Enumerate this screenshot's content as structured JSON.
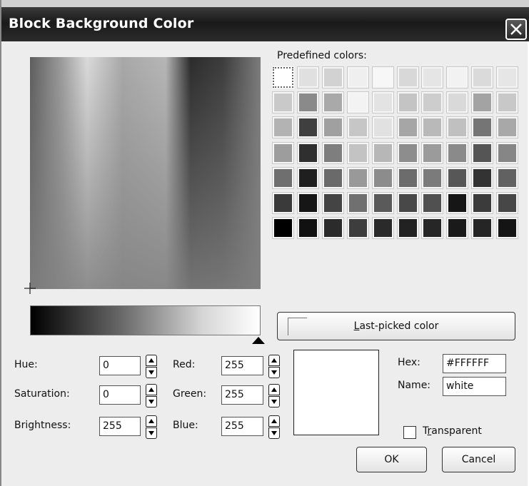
{
  "window": {
    "title": "Block Background Color"
  },
  "predefined": {
    "label": "Predefined colors:",
    "rows": [
      [
        "#ffffff",
        "#e0e0e0",
        "#d2d2d2",
        "#efefef",
        "#f7f7f7",
        "#d8d8d8",
        "#e5e5e5",
        "#f2f2f2",
        "#dadada",
        "#e6e6e6"
      ],
      [
        "#c9c9c9",
        "#8a8a8a",
        "#a9a9a9",
        "#f3f3f3",
        "#e3e3e3",
        "#c4c4c4",
        "#cdcdcd",
        "#d9d9d9",
        "#a3a3a3",
        "#c8c8c8"
      ],
      [
        "#b3b3b3",
        "#3f3f3f",
        "#a0a0a0",
        "#c6c6c6",
        "#e1e1e1",
        "#a6a6a6",
        "#b9b9b9",
        "#c0c0c0",
        "#757575",
        "#a8a8a8"
      ],
      [
        "#9d9d9d",
        "#2f2f2f",
        "#7e7e7e",
        "#c3c3c3",
        "#b7b7b7",
        "#8d8d8d",
        "#9b9b9b",
        "#8a8a8a",
        "#555555",
        "#868686"
      ],
      [
        "#6f6f6f",
        "#1f1f1f",
        "#6a6a6a",
        "#999999",
        "#8c8c8c",
        "#6c6c6c",
        "#7b7b7b",
        "#575757",
        "#333333",
        "#616161"
      ],
      [
        "#3a3a3a",
        "#161616",
        "#444444",
        "#707070",
        "#5a5a5a",
        "#484848",
        "#505050",
        "#161616",
        "#3b3b3b",
        "#474747"
      ],
      [
        "#000000",
        "#111111",
        "#2b2b2b",
        "#3d3d3d",
        "#2a2a2a",
        "#222222",
        "#262626",
        "#1a1a1a",
        "#252525",
        "#141414"
      ]
    ]
  },
  "last_picked": {
    "label": "Last-picked color",
    "accesskey": "L",
    "rest": "ast-picked color"
  },
  "fields": {
    "hue": {
      "label": "Hue:",
      "value": "0"
    },
    "saturation": {
      "label": "Saturation:",
      "value": "0"
    },
    "brightness": {
      "label": "Brightness:",
      "value": "255"
    },
    "red": {
      "label": "Red:",
      "value": "255"
    },
    "green": {
      "label": "Green:",
      "value": "255"
    },
    "blue": {
      "label": "Blue:",
      "value": "255"
    },
    "hex": {
      "label": "Hex:",
      "value": "#FFFFFF"
    },
    "name": {
      "label": "Name:",
      "value": "white"
    }
  },
  "transparent": {
    "label": "Transparent",
    "accesskey": "r",
    "before": "T",
    "after": "ansparent",
    "checked": false
  },
  "preview_color": "#FFFFFF",
  "buttons": {
    "ok": "OK",
    "cancel": "Cancel"
  },
  "icons": {
    "close": "close-icon",
    "crosshair": "crosshair-icon",
    "pointer": "triangle-up-icon"
  }
}
